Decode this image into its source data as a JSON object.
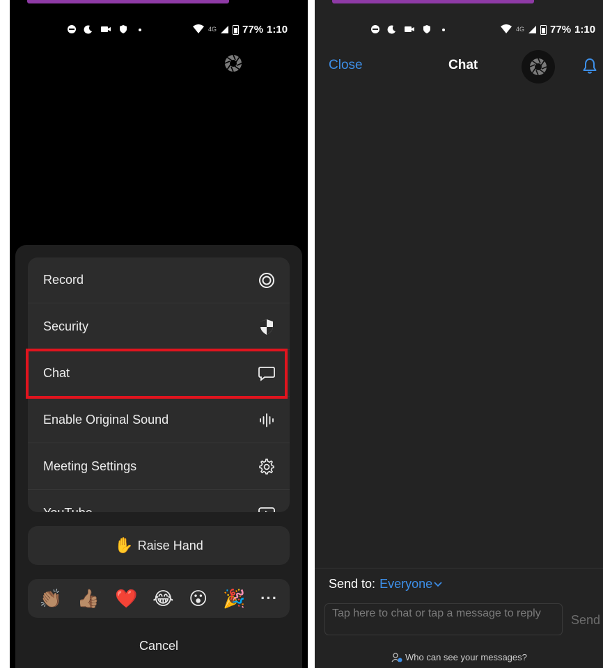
{
  "status_bar": {
    "battery": "77%",
    "time": "1:10",
    "network": "4G"
  },
  "menu": {
    "items": [
      {
        "label": "Record",
        "icon": "record-icon"
      },
      {
        "label": "Security",
        "icon": "shield-icon"
      },
      {
        "label": "Chat",
        "icon": "chat-bubble-icon"
      },
      {
        "label": "Enable Original Sound",
        "icon": "sound-wave-icon"
      },
      {
        "label": "Meeting Settings",
        "icon": "gear-icon"
      },
      {
        "label": "YouTube",
        "icon": "youtube-icon"
      }
    ],
    "highlighted": "Chat",
    "highlight_color": "#e0141e"
  },
  "raise_hand": {
    "label": "Raise Hand",
    "icon": "✋"
  },
  "reactions": [
    "👏🏽",
    "👍🏽",
    "❤️",
    "😂",
    "😮",
    "🎉",
    "···"
  ],
  "cancel_label": "Cancel",
  "chat": {
    "close_label": "Close",
    "title": "Chat",
    "send_to_label": "Send to:",
    "recipient": "Everyone",
    "input_placeholder": "Tap here to chat or tap a message to reply",
    "send_label": "Send",
    "privacy_link": "Who can see your messages?"
  },
  "colors": {
    "accent_blue": "#3d8fe8",
    "screen_bg": "#000000",
    "sheet_bg": "#1f1f1f",
    "card_bg": "#2c2c2c",
    "chat_bg": "#232323",
    "top_strip": "#8e3aa5"
  }
}
